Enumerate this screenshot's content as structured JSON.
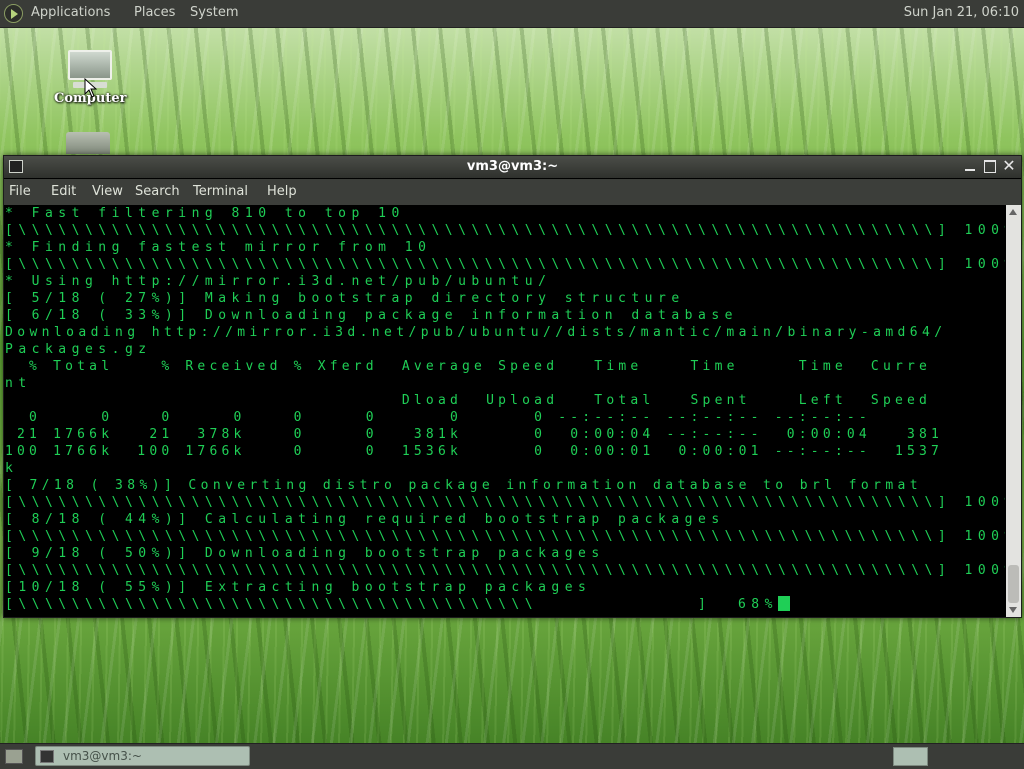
{
  "top_panel": {
    "menus": [
      "Applications",
      "Places",
      "System"
    ],
    "clock": "Sun Jan 21, 06:10"
  },
  "desktop": {
    "icons": [
      {
        "label": "Computer",
        "icon": "computer-icon"
      },
      {
        "label": "",
        "icon": "folder-icon"
      }
    ]
  },
  "terminal": {
    "title": "vm3@vm3:~",
    "menus": [
      "File",
      "Edit",
      "View",
      "Search",
      "Terminal",
      "Help"
    ],
    "lines": [
      {
        "text": "* Fast filtering 810 to top 10",
        "cls": ""
      },
      {
        "text": "[\\\\\\\\\\\\\\\\\\\\\\\\\\\\\\\\\\\\\\\\\\\\\\\\\\\\\\\\\\\\\\\\\\\\\\\\\\\\\\\\\\\\\\\\\\\\\\\\\\\\\\\\\\\\\\\\\\\\\\\\\\\\\\\\\\\\\\\\\\] 100%",
        "cls": ""
      },
      {
        "text": "* Finding fastest mirror from 10",
        "cls": ""
      },
      {
        "text": "[\\\\\\\\\\\\\\\\\\\\\\\\\\\\\\\\\\\\\\\\\\\\\\\\\\\\\\\\\\\\\\\\\\\\\\\\\\\\\\\\\\\\\\\\\\\\\\\\\\\\\\\\\\\\\\\\\\\\\\\\\\\\\\\\\\\\\\\\\\] 100%",
        "cls": ""
      },
      {
        "text": "* Using http://mirror.i3d.net/pub/ubuntu/",
        "cls": ""
      },
      {
        "text": "[ 5/18 ( 27%)] Making bootstrap directory structure",
        "cls": ""
      },
      {
        "text": "[ 6/18 ( 33%)] Downloading package information database",
        "cls": ""
      },
      {
        "text": "Downloading http://mirror.i3d.net/pub/ubuntu//dists/mantic/main/binary-amd64/",
        "cls": "wrap"
      },
      {
        "text": "Packages.gz",
        "cls": ""
      },
      {
        "text": "  % Total    % Received % Xferd  Average Speed   Time    Time     Time  Curre",
        "cls": "speed"
      },
      {
        "text": "nt",
        "cls": ""
      },
      {
        "text": "                                 Dload  Upload   Total   Spent    Left  Speed",
        "cls": "speed"
      },
      {
        "text": "  0     0    0     0    0     0      0      0 --:--:-- --:--:-- --:--:--",
        "cls": "speed"
      },
      {
        "text": " 21 1766k   21  378k    0     0   381k      0  0:00:04 --:--:--  0:00:04   381",
        "cls": "speed"
      },
      {
        "text": "100 1766k  100 1766k    0     0  1536k      0  0:00:01  0:00:01 --:--:--  1537",
        "cls": "speed"
      },
      {
        "text": "k",
        "cls": ""
      },
      {
        "text": "[ 7/18 ( 38%)] Converting distro package information database to brl format",
        "cls": "wrap"
      },
      {
        "text": "[\\\\\\\\\\\\\\\\\\\\\\\\\\\\\\\\\\\\\\\\\\\\\\\\\\\\\\\\\\\\\\\\\\\\\\\\\\\\\\\\\\\\\\\\\\\\\\\\\\\\\\\\\\\\\\\\\\\\\\\\\\\\\\\\\\\\\\\\\\] 100%",
        "cls": ""
      },
      {
        "text": "[ 8/18 ( 44%)] Calculating required bootstrap packages",
        "cls": ""
      },
      {
        "text": "[\\\\\\\\\\\\\\\\\\\\\\\\\\\\\\\\\\\\\\\\\\\\\\\\\\\\\\\\\\\\\\\\\\\\\\\\\\\\\\\\\\\\\\\\\\\\\\\\\\\\\\\\\\\\\\\\\\\\\\\\\\\\\\\\\\\\\\\\\\] 100%",
        "cls": ""
      },
      {
        "text": "[ 9/18 ( 50%)] Downloading bootstrap packages",
        "cls": ""
      },
      {
        "text": "[\\\\\\\\\\\\\\\\\\\\\\\\\\\\\\\\\\\\\\\\\\\\\\\\\\\\\\\\\\\\\\\\\\\\\\\\\\\\\\\\\\\\\\\\\\\\\\\\\\\\\\\\\\\\\\\\\\\\\\\\\\\\\\\\\\\\\\\\\\] 100%",
        "cls": ""
      },
      {
        "text": "[10/18 ( 55%)] Extracting bootstrap packages",
        "cls": ""
      },
      {
        "text": "[\\\\\\\\\\\\\\\\\\\\\\\\\\\\\\\\\\\\\\\\\\\\\\\\\\\\\\\\\\\\\\\\\\\\\\\\\\\\\\            ]  68%",
        "cls": "",
        "cursor": true
      }
    ]
  },
  "bottom_panel": {
    "task_label": "vm3@vm3:~"
  },
  "colors": {
    "terminal_fg": "#1fcf56",
    "terminal_bg": "#000000",
    "panel_bg": "#3a3c38"
  }
}
